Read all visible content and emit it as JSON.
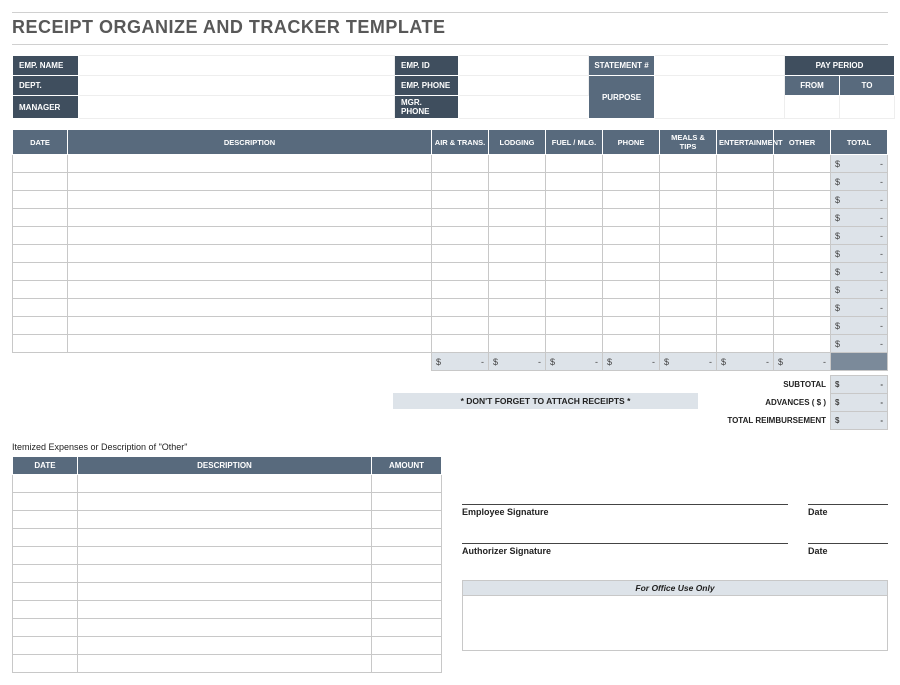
{
  "title": "RECEIPT ORGANIZE AND TRACKER TEMPLATE",
  "info": {
    "emp_name": "EMP. NAME",
    "emp_id": "EMP. ID",
    "statement": "STATEMENT #",
    "pay_period": "PAY PERIOD",
    "dept": "DEPT.",
    "emp_phone": "EMP. PHONE",
    "purpose": "PURPOSE",
    "from": "FROM",
    "to": "TO",
    "manager": "MANAGER",
    "mgr_phone": "MGR. PHONE"
  },
  "columns": {
    "date": "DATE",
    "description": "DESCRIPTION",
    "air": "AIR & TRANS.",
    "lodging": "LODGING",
    "fuel": "FUEL / MLG.",
    "phone": "PHONE",
    "meals": "MEALS & TIPS",
    "ent": "ENTERTAINMENT",
    "other": "OTHER",
    "total": "TOTAL"
  },
  "money": {
    "sym": "$",
    "dash": "-"
  },
  "summary": {
    "subtotal": "SUBTOTAL",
    "advances": "ADVANCES  ( $ )",
    "total_reimb": "TOTAL REIMBURSEMENT"
  },
  "reminder": "* DON'T FORGET TO ATTACH RECEIPTS *",
  "itemized": {
    "caption": "Itemized Expenses or Description of \"Other\"",
    "date": "DATE",
    "description": "DESCRIPTION",
    "amount": "AMOUNT"
  },
  "sign": {
    "emp": "Employee Signature",
    "auth": "Authorizer Signature",
    "date": "Date"
  },
  "office": "For Office Use Only"
}
